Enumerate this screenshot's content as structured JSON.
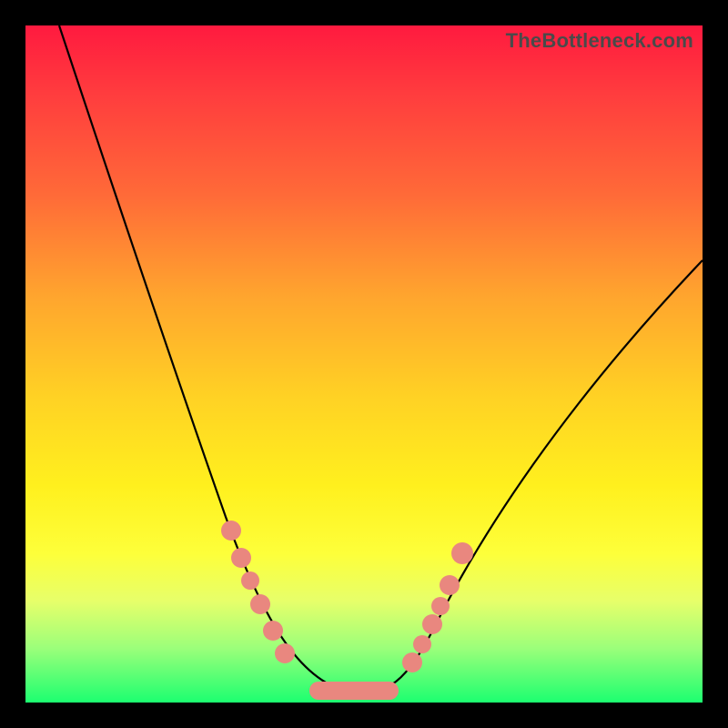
{
  "watermark": "TheBottleneck.com",
  "colors": {
    "frame": "#000000",
    "gradient_top": "#ff1a3f",
    "gradient_mid": "#fff01e",
    "gradient_bottom": "#1cff70",
    "curve": "#000000",
    "markers": "#e9877f"
  },
  "chart_data": {
    "type": "line",
    "title": "",
    "xlabel": "",
    "ylabel": "",
    "xlim": [
      0,
      100
    ],
    "ylim": [
      0,
      100
    ],
    "grid": false,
    "legend": false,
    "note": "No axis tick labels are rendered in the image; x/y units are normalized 0–100 as a best estimate from pixel positions.",
    "series": [
      {
        "name": "bottleneck-curve",
        "x": [
          5,
          10,
          15,
          20,
          25,
          30,
          35,
          40,
          43,
          46,
          48,
          50,
          52,
          55,
          58,
          62,
          68,
          75,
          82,
          90,
          100
        ],
        "y": [
          100,
          85,
          71,
          59,
          48,
          38,
          29,
          20,
          13,
          7,
          3,
          1,
          1,
          3,
          8,
          15,
          24,
          34,
          44,
          54,
          66
        ]
      }
    ],
    "markers": {
      "name": "highlight-points",
      "x": [
        30,
        32,
        33,
        35,
        37,
        38,
        56,
        57.5,
        59,
        60,
        61.5,
        63
      ],
      "y": [
        38,
        33,
        30,
        26,
        21,
        17,
        10,
        13,
        16,
        19,
        22,
        27
      ]
    },
    "trough_segment": {
      "x_start": 43,
      "x_end": 53,
      "y": 1
    }
  }
}
